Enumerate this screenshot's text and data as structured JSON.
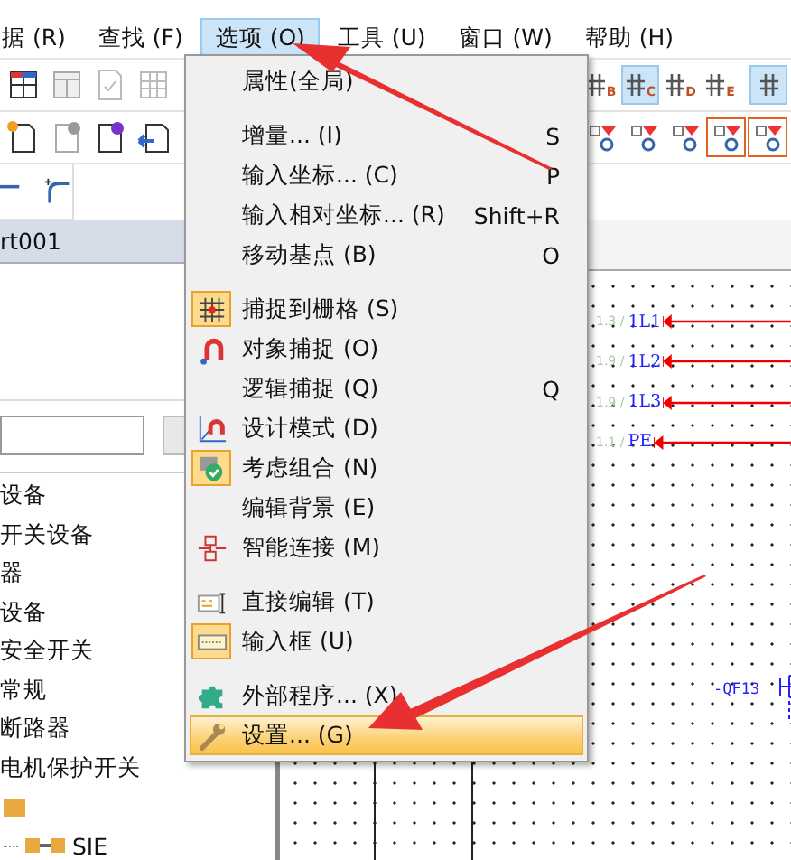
{
  "menubar": [
    {
      "label": "据 (R)",
      "selected": false
    },
    {
      "label": "查找 (F)",
      "selected": false
    },
    {
      "label": "选项 (O)",
      "selected": true
    },
    {
      "label": "工具 (U)",
      "selected": false
    },
    {
      "label": "窗口 (W)",
      "selected": false
    },
    {
      "label": "帮助 (H)",
      "selected": false
    }
  ],
  "grid_buttons": [
    {
      "label": "B",
      "selected": false
    },
    {
      "label": "C",
      "selected": true
    },
    {
      "label": "D",
      "selected": false
    },
    {
      "label": "E",
      "selected": false
    },
    {
      "selected": true
    }
  ],
  "panel": {
    "dropdown": "rt001",
    "tree": [
      {
        "label": "设备"
      },
      {
        "label": "开关设备"
      },
      {
        "label": "器"
      },
      {
        "label": "设备"
      },
      {
        "label": "安全开关"
      },
      {
        "label": "常规"
      },
      {
        "label": "断路器"
      },
      {
        "label": "电机保护开关"
      },
      {
        "children": [
          {
            "label": "SIE"
          }
        ]
      }
    ]
  },
  "menu": {
    "items": [
      {
        "kind": "item",
        "label": "属性(全局)",
        "checked": false,
        "selected": false
      },
      {
        "kind": "separator"
      },
      {
        "kind": "item",
        "label": "增量... (I)",
        "shortcut": "S",
        "checked": false,
        "selected": false
      },
      {
        "kind": "item",
        "label": "输入坐标... (C)",
        "shortcut": "P",
        "checked": false,
        "selected": false
      },
      {
        "kind": "item",
        "label": "输入相对坐标... (R)",
        "shortcut": "Shift+R",
        "checked": false,
        "selected": false
      },
      {
        "kind": "item",
        "label": "移动基点 (B)",
        "shortcut": "O",
        "checked": false,
        "selected": false
      },
      {
        "kind": "separator"
      },
      {
        "kind": "item",
        "label": "捕捉到栅格 (S)",
        "checked": true,
        "selected": false
      },
      {
        "kind": "item",
        "label": "对象捕捉 (O)",
        "checked": false,
        "selected": false
      },
      {
        "kind": "item",
        "label": "逻辑捕捉 (Q)",
        "shortcut": "Q",
        "checked": false,
        "selected": false
      },
      {
        "kind": "item",
        "label": "设计模式 (D)",
        "checked": false,
        "selected": false
      },
      {
        "kind": "item",
        "label": "考虑组合 (N)",
        "checked": true,
        "selected": false
      },
      {
        "kind": "item",
        "label": "编辑背景 (E)",
        "checked": false,
        "selected": false
      },
      {
        "kind": "item",
        "label": "智能连接 (M)",
        "checked": false,
        "selected": false
      },
      {
        "kind": "separator"
      },
      {
        "kind": "item",
        "label": "直接编辑 (T)",
        "checked": false,
        "selected": false
      },
      {
        "kind": "item",
        "label": "输入框 (U)",
        "checked": true,
        "selected": false
      },
      {
        "kind": "separator"
      },
      {
        "kind": "item",
        "label": "外部程序... (X)",
        "checked": false,
        "selected": false
      },
      {
        "kind": "item",
        "label": "设置... (G)",
        "checked": false,
        "selected": true
      }
    ]
  },
  "canvas": {
    "signals": [
      {
        "ref": "1.3 /",
        "label": "1L1"
      },
      {
        "ref": "1.9 /",
        "label": "1L2"
      },
      {
        "ref": "1.9 /",
        "label": "1L3"
      },
      {
        "ref": "1.1 /",
        "label": "PE"
      }
    ],
    "device": "-QF13"
  }
}
